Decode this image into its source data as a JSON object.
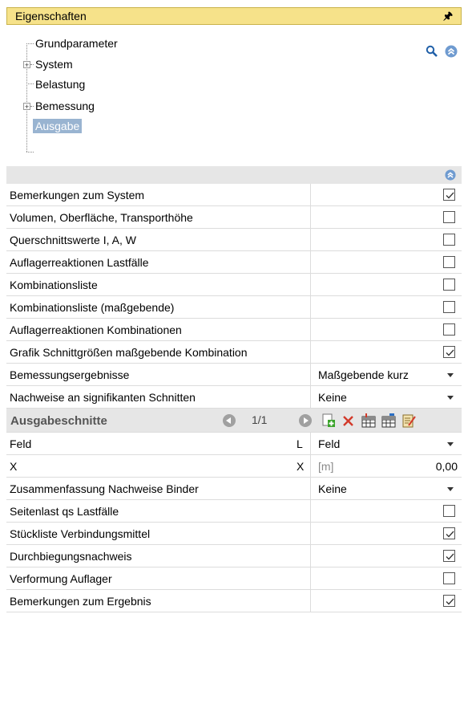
{
  "panel": {
    "title": "Eigenschaften"
  },
  "tree": {
    "items": [
      {
        "label": "Grundparameter",
        "expandable": false
      },
      {
        "label": "System",
        "expandable": true
      },
      {
        "label": "Belastung",
        "expandable": false
      },
      {
        "label": "Bemessung",
        "expandable": true
      },
      {
        "label": "Ausgabe",
        "expandable": false,
        "selected": true
      }
    ]
  },
  "rows": [
    {
      "label": "Bemerkungen zum System",
      "checked": true
    },
    {
      "label": "Volumen, Oberfläche, Transporthöhe",
      "checked": false
    },
    {
      "label": "Querschnittswerte I, A, W",
      "checked": false
    },
    {
      "label": "Auflagerreaktionen Lastfälle",
      "checked": false
    },
    {
      "label": "Kombinationsliste",
      "checked": false
    },
    {
      "label": "Kombinationsliste (maßgebende)",
      "checked": false
    },
    {
      "label": "Auflagerreaktionen Kombinationen",
      "checked": false
    },
    {
      "label": "Grafik Schnittgrößen maßgebende Kombination",
      "checked": true
    }
  ],
  "dropdowns": [
    {
      "label": "Bemessungsergebnisse",
      "value": "Maßgebende kurz"
    },
    {
      "label": "Nachweise an signifikanten Schnitten",
      "value": "Keine"
    }
  ],
  "section": {
    "title": "Ausgabeschnitte",
    "page": "1/1"
  },
  "section_rows": {
    "feld": {
      "label": "Feld",
      "symbol": "L",
      "value": "Feld"
    },
    "x": {
      "label": "X",
      "symbol": "X",
      "unit": "[m]",
      "value": "0,00"
    }
  },
  "summary": {
    "label": "Zusammenfassung Nachweise Binder",
    "value": "Keine"
  },
  "rows2": [
    {
      "label": "Seitenlast qs Lastfälle",
      "checked": false
    },
    {
      "label": "Stückliste Verbindungsmittel",
      "checked": true
    },
    {
      "label": "Durchbiegungsnachweis",
      "checked": true
    },
    {
      "label": "Verformung Auflager",
      "checked": false
    },
    {
      "label": "Bemerkungen zum Ergebnis",
      "checked": true
    }
  ]
}
